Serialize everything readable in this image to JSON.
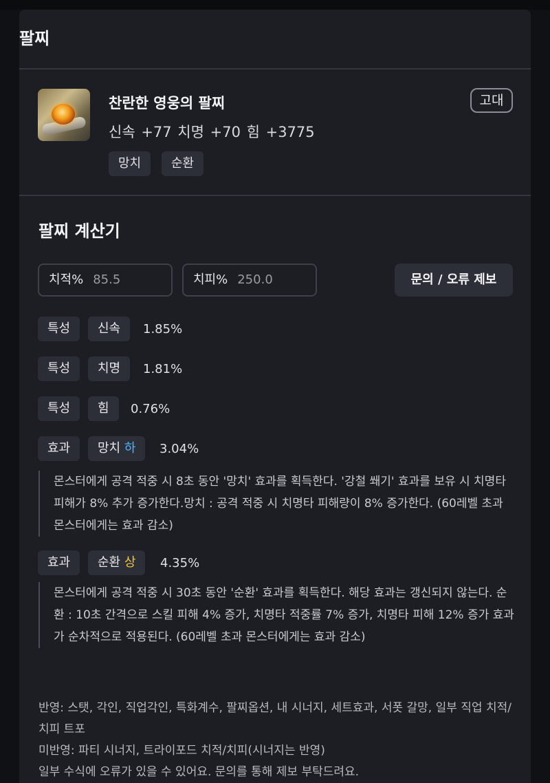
{
  "header": {
    "title": "팔찌"
  },
  "item": {
    "name": "찬란한 영웅의 팔찌",
    "stats": "신속 +77   치명 +70   힘 +3775",
    "grade": "고대",
    "tags": [
      "망치",
      "순환"
    ]
  },
  "calculator": {
    "title": "팔찌 계산기",
    "crit_rate": {
      "label": "치적%",
      "value": "85.5"
    },
    "crit_dmg": {
      "label": "치피%",
      "value": "250.0"
    },
    "report_button": "문의 / 오류 제보",
    "rows": [
      {
        "kind": "특성",
        "name": "신속",
        "level": "",
        "value": "1.85%"
      },
      {
        "kind": "특성",
        "name": "치명",
        "level": "",
        "value": "1.81%"
      },
      {
        "kind": "특성",
        "name": "힘",
        "level": "",
        "value": "0.76%"
      },
      {
        "kind": "효과",
        "name": "망치",
        "level": "하",
        "value": "3.04%",
        "desc": "몬스터에게 공격 적중 시 8초 동안 '망치' 효과를 획득한다. '강철 쐐기' 효과를 보유 시 치명타 피해가 8% 추가 증가한다.망치 : 공격 적중 시 치명타 피해량이 8% 증가한다. (60레벨 초과 몬스터에게는 효과 감소)"
      },
      {
        "kind": "효과",
        "name": "순환",
        "level": "상",
        "value": "4.35%",
        "desc": "몬스터에게 공격 적중 시 30초 동안 '순환' 효과를 획득한다. 해당 효과는 갱신되지 않는다. 순환 : 10초 간격으로 스킬 피해 4% 증가, 치명타 적중률 7% 증가, 치명타 피해 12% 증가 효과가 순차적으로 적용된다. (60레벨 초과 몬스터에게는 효과 감소)"
      }
    ]
  },
  "footer": {
    "applied": "반영: 스탯, 각인, 직업각인, 특화계수, 팔찌옵션, 내 시너지, 세트효과, 서폿 갈망, 일부 직업 치적/치피 트포",
    "not_applied": "미반영: 파티 시너지, 트라이포드 치적/치피(시너지는 반영)",
    "note": "일부 수식에 오류가 있을 수 있어요. 문의를 통해 제보 부탁드려요."
  },
  "colors": {
    "level_low": "#4fb3ff",
    "level_high": "#f5c542",
    "background": "#1c1e24"
  }
}
